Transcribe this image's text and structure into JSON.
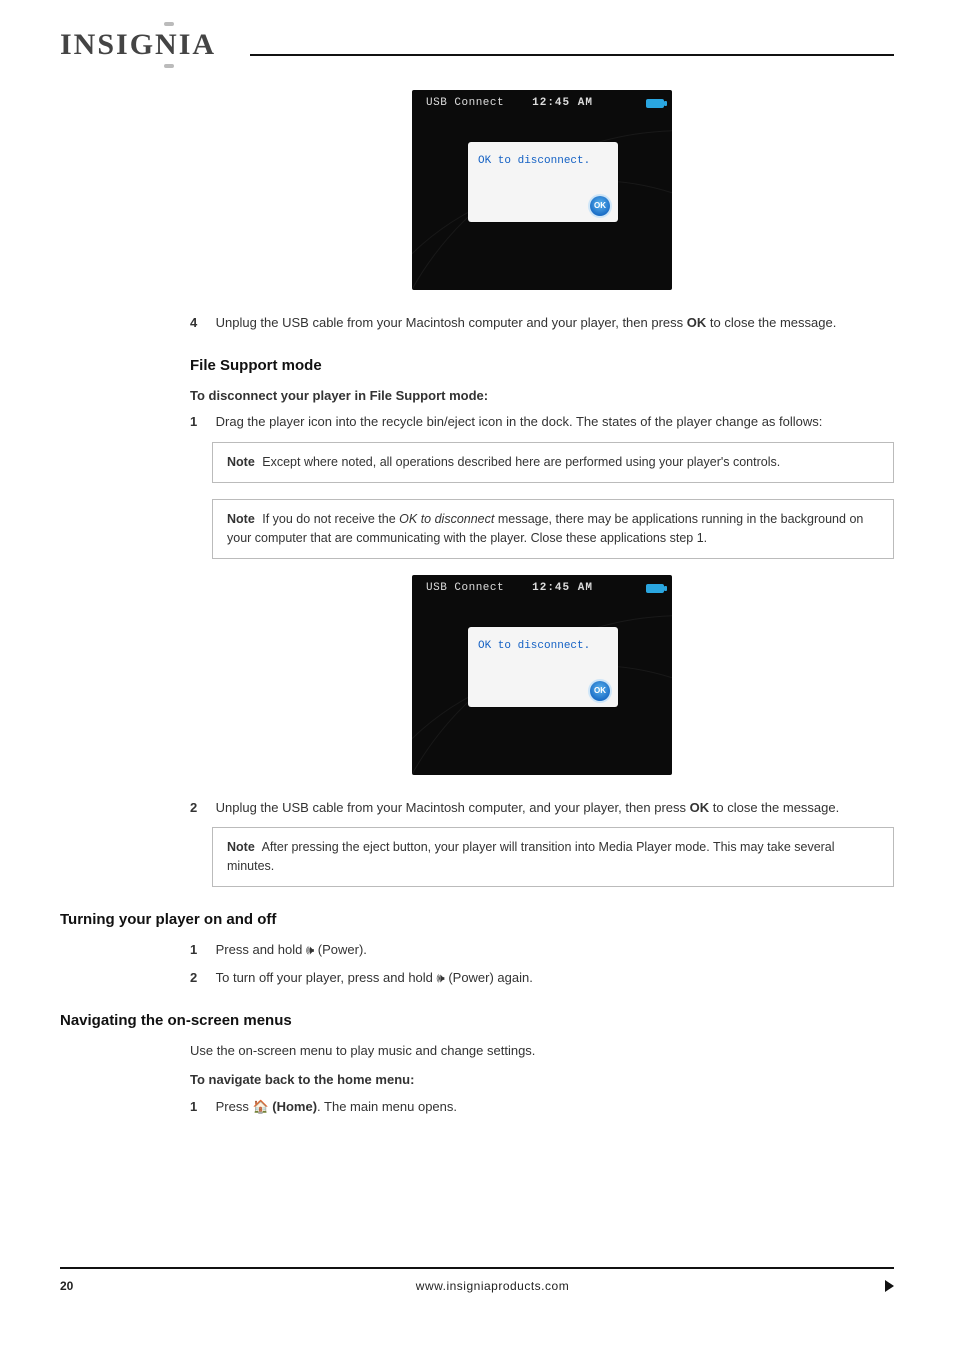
{
  "logo_text": "INSIGNIA",
  "screen1": {
    "title": "USB Connect",
    "time": "12:45 AM",
    "message": "OK to disconnect.",
    "ok": "OK"
  },
  "screen2": {
    "title": "USB Connect",
    "time": "12:45 AM",
    "message": "OK to disconnect.",
    "ok": "OK"
  },
  "step4_num": "4",
  "step4_text_a": "Unplug the USB cable from your Macintosh computer and your player, then press ",
  "step4_bold": "OK",
  "step4_text_b": " to close the message.",
  "file_support_heading": "File Support mode",
  "file_support_intro": "To disconnect your player in File Support mode:",
  "fs_step1_num": "1",
  "fs_step1_text": "Drag the player icon into the recycle bin/eject icon in the dock. The states of the player change as follows:",
  "note1_label": "Note",
  "note1_text": "Except where noted, all operations described here are performed using your player's controls.",
  "note2_label": "Note",
  "note2_text_a": "If you do not receive the ",
  "note2_ital": "OK to disconnect",
  "note2_text_b": " message, there may be applications running in the background on your computer that are communicating with the player. Close these applications step 1.",
  "fs_step2_num": "2",
  "fs_step2_text_a": "Unplug the USB cable from your Macintosh computer, and your player, then press ",
  "fs_step2_bold": "OK",
  "fs_step2_text_b": " to close the message.",
  "note3_label": "Note",
  "note3_text": "After pressing the eject button, your player will transition into Media Player mode. This may take several minutes.",
  "h_turning": "Turning your player on and off",
  "turning_step1_num": "1",
  "turning_step1_text": "Press and hold 🕪 (Power).",
  "turning_step2_num": "2",
  "turning_step2_text": "To turn off your player, press and hold 🕪 (Power) again.",
  "h_nav": "Navigating the on-screen menus",
  "nav_intro": "Use the on-screen menu to play music and change settings.",
  "h_home": "To navigate back to the home menu:",
  "home_step1_num": "1",
  "home_step1_text_a": "Press 🏠 ",
  "home_step1_bold": "(Home)",
  "home_step1_text_b": ". The main menu opens.",
  "footer_page": "20",
  "footer_url": "www.insigniaproducts.com"
}
